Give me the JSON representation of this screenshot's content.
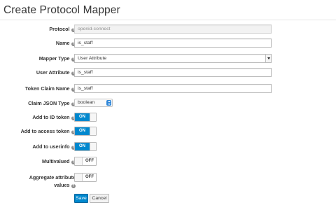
{
  "page": {
    "title": "Create Protocol Mapper"
  },
  "help_icon_glyph": "?",
  "fields": {
    "protocol": {
      "label": "Protocol",
      "value": "openid-connect"
    },
    "name": {
      "label": "Name",
      "value": "is_staff"
    },
    "mapper_type": {
      "label": "Mapper Type",
      "value": "User Attribute"
    },
    "user_attribute": {
      "label": "User Attribute",
      "value": "is_staff"
    },
    "token_claim_name": {
      "label": "Token Claim Name",
      "value": "is_staff"
    },
    "claim_json_type": {
      "label": "Claim JSON Type",
      "value": "boolean"
    },
    "add_to_id_token": {
      "label": "Add to ID token",
      "state": "ON"
    },
    "add_to_access_token": {
      "label": "Add to access token",
      "state": "ON"
    },
    "add_to_userinfo": {
      "label": "Add to userinfo",
      "state": "ON"
    },
    "multivalued": {
      "label": "Multivalued",
      "state": "OFF"
    },
    "aggregate_attribute_values": {
      "label": "Aggregate attribute values",
      "state": "OFF"
    }
  },
  "buttons": {
    "save": "Save",
    "cancel": "Cancel"
  },
  "colors": {
    "accent": "#0088ce",
    "border": "#bbbbbb",
    "readonly_bg": "#f2f2f2"
  },
  "icons": {
    "help": "question-circle-icon",
    "select": "chevron-down-icon",
    "spinner": "up-down-arrows-icon"
  }
}
